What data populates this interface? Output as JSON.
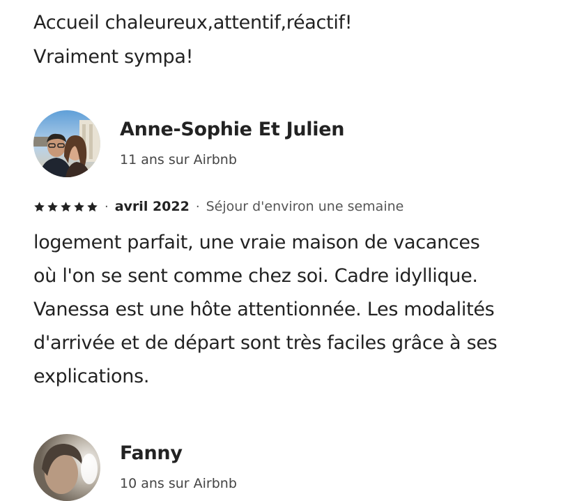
{
  "previous_review": {
    "lines": [
      "Accueil chaleureux,attentif,réactif!",
      "Vraiment sympa!"
    ]
  },
  "reviews": [
    {
      "name": "Anne-Sophie Et Julien",
      "tenure": "11 ans sur Airbnb",
      "avatar_icon": "couple-photo-avatar",
      "rating_stars": 5,
      "date": "avril 2022",
      "stay": "Séjour d'environ une semaine",
      "body_lines": [
        "logement parfait, une vraie maison de vacances",
        "où l'on se sent comme chez soi. Cadre idyllique.",
        "Vanessa est une hôte attentionnée. Les modalités",
        "d'arrivée et de départ sont très faciles grâce à ses",
        "explications."
      ]
    },
    {
      "name": "Fanny",
      "tenure": "10 ans sur Airbnb",
      "avatar_icon": "person-photo-avatar"
    }
  ],
  "colors": {
    "text": "#222222",
    "secondary_text": "#555555",
    "star": "#222222"
  }
}
